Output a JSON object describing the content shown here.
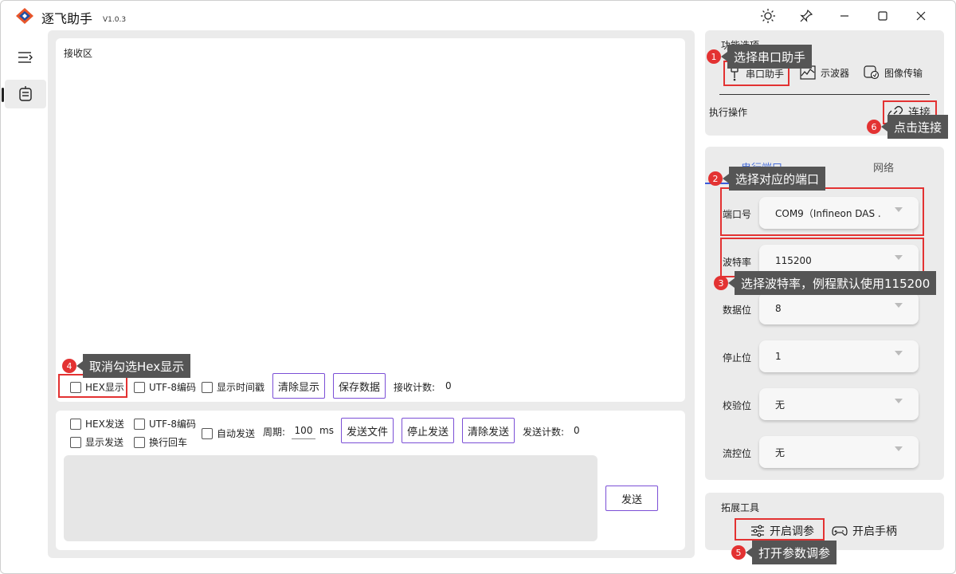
{
  "app": {
    "title": "逐飞助手",
    "version": "V1.0.3"
  },
  "receive": {
    "area_label": "接收区",
    "hex_display": "HEX显示",
    "utf8": "UTF-8编码",
    "show_timestamp": "显示时间戳",
    "clear_btn": "清除显示",
    "save_btn": "保存数据",
    "count_label": "接收计数:",
    "count_value": "0"
  },
  "send": {
    "hex_send": "HEX发送",
    "utf8": "UTF-8编码",
    "show_send": "显示发送",
    "newline": "换行回车",
    "auto_send": "自动发送",
    "period_label": "周期:",
    "period_value": "100",
    "period_unit": "ms",
    "send_file_btn": "发送文件",
    "stop_send_btn": "停止发送",
    "clear_send_btn": "清除发送",
    "count_label": "发送计数:",
    "count_value": "0",
    "send_btn": "发送"
  },
  "functions": {
    "title": "功能选项",
    "items": [
      "串口助手",
      "示波器",
      "图像传输"
    ],
    "exec_label": "执行操作",
    "connect_btn": "连接"
  },
  "port": {
    "tabs": [
      "串行端口",
      "网络"
    ],
    "fields": [
      {
        "label": "端口号",
        "value": "COM9（Infineon DAS ."
      },
      {
        "label": "波特率",
        "value": "115200"
      },
      {
        "label": "数据位",
        "value": "8"
      },
      {
        "label": "停止位",
        "value": "1"
      },
      {
        "label": "校验位",
        "value": "无"
      },
      {
        "label": "流控位",
        "value": "无"
      }
    ]
  },
  "tools": {
    "title": "拓展工具",
    "tune_btn": "开启调参",
    "gamepad_btn": "开启手柄"
  },
  "annotations": [
    {
      "num": "1",
      "text": "选择串口助手"
    },
    {
      "num": "2",
      "text": "选择对应的端口"
    },
    {
      "num": "3",
      "text": "选择波特率，例程默认使用115200"
    },
    {
      "num": "4",
      "text": "取消勾选Hex显示"
    },
    {
      "num": "5",
      "text": "打开参数调参"
    },
    {
      "num": "6",
      "text": "点击连接"
    }
  ],
  "colors": {
    "accent": "#7b4fd6",
    "annotation_red": "#e33232",
    "tooltip_bg": "#555555",
    "tab_underline": "#3b5bdb"
  }
}
